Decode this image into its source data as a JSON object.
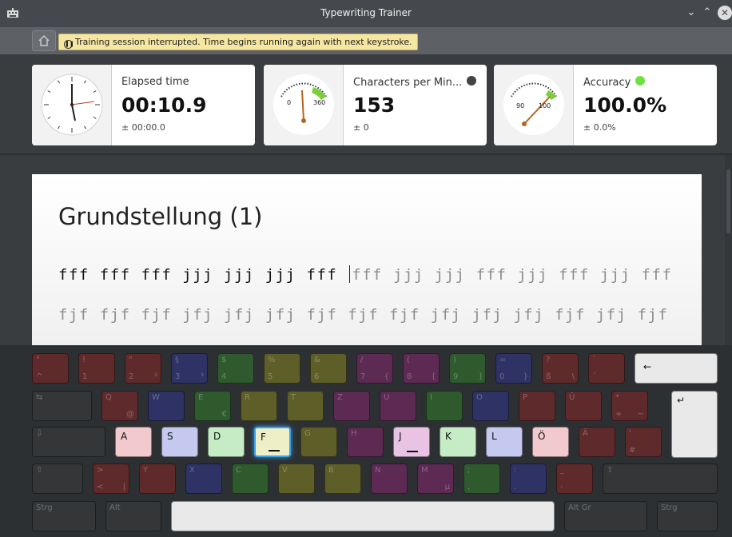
{
  "window": {
    "title": "Typewriting Trainer"
  },
  "notice": "Training session interrupted. Time begins running again with next keystroke.",
  "stats": [
    {
      "label": "Elapsed time",
      "value": "00:10.9",
      "deviation": "± 00:00.0"
    },
    {
      "label": "Characters per Min...",
      "value": "153",
      "deviation": "± 0",
      "indicator_color": "#444444",
      "gauge_low": "0",
      "gauge_high": "360"
    },
    {
      "label": "Accuracy",
      "value": "100.0%",
      "deviation": "± 0.0%",
      "indicator_color": "#70e040",
      "gauge_low": "90",
      "gauge_high": "100"
    }
  ],
  "lesson": {
    "title": "Grundstellung (1)",
    "line1_typed": "fff fff fff jjj jjj jjj fff ",
    "line1_rest": "fff jjj jjj fff jjj fff jjj fff",
    "line2": "fjf fjf fjf jfj jfj jfj fjf fjf fjf jfj jfj jfj fjf jfj fjf"
  },
  "keyboard": {
    "row1": [
      {
        "top": "°",
        "bot": "^",
        "color": "red"
      },
      {
        "top": "!",
        "bot": "1",
        "color": "red"
      },
      {
        "top": "\"",
        "bot": "2",
        "right": "²",
        "color": "red"
      },
      {
        "top": "§",
        "bot": "3",
        "right": "³",
        "color": "blue"
      },
      {
        "top": "$",
        "bot": "4",
        "color": "green"
      },
      {
        "top": "%",
        "bot": "5",
        "color": "olive"
      },
      {
        "top": "&",
        "bot": "6",
        "color": "olive"
      },
      {
        "top": "/",
        "bot": "7",
        "right": "{",
        "color": "pink"
      },
      {
        "top": "(",
        "bot": "8",
        "right": "[",
        "color": "pink"
      },
      {
        "top": ")",
        "bot": "9",
        "right": "]",
        "color": "green"
      },
      {
        "top": "=",
        "bot": "0",
        "right": "}",
        "color": "blue"
      },
      {
        "top": "?",
        "bot": "ß",
        "right": "\\",
        "color": "red"
      },
      {
        "top": "`",
        "bot": "´",
        "color": "red"
      }
    ],
    "backspace": "←",
    "tab": "⇆",
    "row2": [
      {
        "top": "Q",
        "right": "@",
        "color": "red"
      },
      {
        "top": "W",
        "color": "blue"
      },
      {
        "top": "E",
        "right": "€",
        "color": "green"
      },
      {
        "top": "R",
        "color": "olive"
      },
      {
        "top": "T",
        "color": "olive"
      },
      {
        "top": "Z",
        "color": "pink"
      },
      {
        "top": "U",
        "color": "pink"
      },
      {
        "top": "I",
        "color": "green"
      },
      {
        "top": "O",
        "color": "blue"
      },
      {
        "top": "P",
        "color": "red"
      },
      {
        "top": "Ü",
        "color": "red"
      },
      {
        "top": "*",
        "bot": "+",
        "right": "~",
        "color": "red"
      }
    ],
    "enter": "↵",
    "capslock": "⇩",
    "row3": [
      {
        "top": "A",
        "color": "#f2c9cd",
        "light": true
      },
      {
        "top": "S",
        "color": "#c5c8ef",
        "light": true
      },
      {
        "top": "D",
        "color": "#c6ecc5",
        "light": true
      },
      {
        "top": "F",
        "color": "#efefc7",
        "light": true,
        "active": true,
        "bar": true
      },
      {
        "top": "G",
        "color": "olive"
      },
      {
        "top": "H",
        "color": "pink"
      },
      {
        "top": "J",
        "color": "#e8c3e3",
        "light": true,
        "bar": true
      },
      {
        "top": "K",
        "color": "#c6ecc5",
        "light": true
      },
      {
        "top": "L",
        "color": "#c5c8ef",
        "light": true
      },
      {
        "top": "Ö",
        "color": "#f2c9cd",
        "light": true
      },
      {
        "top": "Ä",
        "color": "red"
      },
      {
        "top": "'",
        "bot": "#",
        "color": "red"
      }
    ],
    "shift": "⇧",
    "row4": [
      {
        "top": ">",
        "bot": "<",
        "right": "|",
        "color": "red"
      },
      {
        "top": "Y",
        "color": "red"
      },
      {
        "top": "X",
        "color": "blue"
      },
      {
        "top": "C",
        "color": "green"
      },
      {
        "top": "V",
        "color": "olive"
      },
      {
        "top": "B",
        "color": "olive"
      },
      {
        "top": "N",
        "color": "pink"
      },
      {
        "top": "M",
        "right": "µ",
        "color": "pink"
      },
      {
        "top": ";",
        "bot": ",",
        "color": "green"
      },
      {
        "top": ":",
        "bot": ".",
        "color": "blue"
      },
      {
        "top": "_",
        "bot": "-",
        "color": "red"
      }
    ],
    "strg_left": "Strg",
    "alt": "Alt",
    "altgr": "Alt Gr",
    "strg_right": "Strg"
  }
}
